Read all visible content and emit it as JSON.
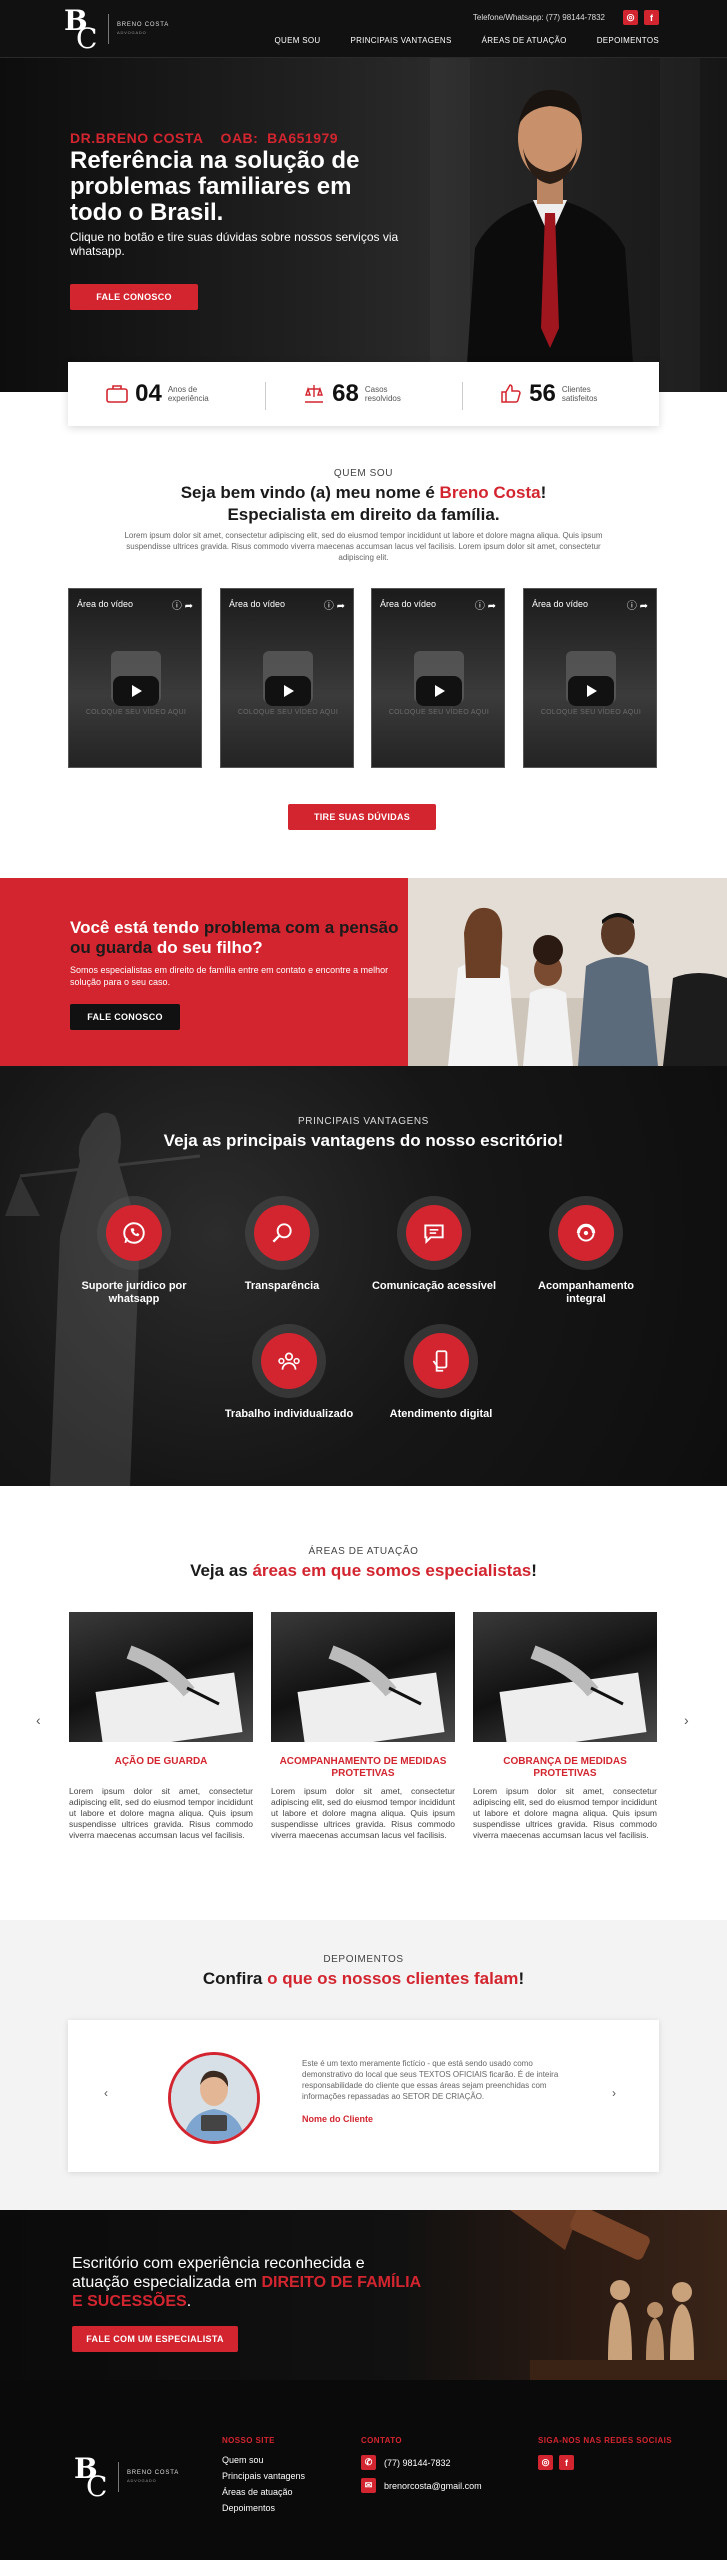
{
  "header": {
    "logo_text_1": "BRENO COSTA",
    "logo_text_2": "ADVOGADO",
    "phone": "Telefone/Whatsapp: (77) 98144-7832",
    "nav": [
      "QUEM SOU",
      "PRINCIPAIS VANTAGENS",
      "ÁREAS DE ATUAÇÃO",
      "DEPOIMENTOS"
    ]
  },
  "hero": {
    "kicker": "DR.BRENO COSTA    OAB:  BA651979",
    "title": "Referência na solução de problemas familiares em todo o Brasil.",
    "subtitle": "Clique no botão e tire suas dúvidas sobre nossos serviços via whatsapp.",
    "button": "FALE CONOSCO"
  },
  "stats": [
    {
      "icon": "briefcase-icon",
      "number": "04",
      "label": "Anos de experiência"
    },
    {
      "icon": "scale-hand-icon",
      "number": "68",
      "label": "Casos resolvidos"
    },
    {
      "icon": "thumbs-up-icon",
      "number": "56",
      "label": "Clientes satisfeitos"
    }
  ],
  "about": {
    "kicker": "QUEM SOU",
    "title_pre": "Seja bem vindo (a) meu nome é ",
    "title_name": "Breno Costa",
    "title_post": "!",
    "title_line2": "Especialista em direito da família.",
    "text": "Lorem ipsum dolor sit amet, consectetur adipiscing elit, sed do eiusmod tempor incididunt ut labore et dolore magna aliqua. Quis ipsum suspendisse ultrices gravida. Risus commodo viverra maecenas accumsan lacus vel facilisis.  Lorem ipsum dolor sit amet, consectetur adipiscing elit.",
    "videos": [
      {
        "title": "Área do vídeo",
        "caption": "COLOQUE SEU VÍDEO AQUI"
      },
      {
        "title": "Área do vídeo",
        "caption": "COLOQUE SEU VÍDEO AQUI"
      },
      {
        "title": "Área do vídeo",
        "caption": "COLOQUE SEU VÍDEO AQUI"
      },
      {
        "title": "Área do vídeo",
        "caption": "COLOQUE SEU VÍDEO AQUI"
      }
    ],
    "button": "TIRE SUAS DÚVIDAS"
  },
  "problem": {
    "t1": "Você está tendo ",
    "t2": "problema com a pensão ou guarda",
    "t3": " do seu filho?",
    "text": "Somos especialistas em direito de família entre em contato e encontre a melhor solução para o seu caso.",
    "button": "FALE CONOSCO"
  },
  "advantages": {
    "kicker": "PRINCIPAIS VANTAGENS",
    "title": "Veja as principais vantagens do nosso escritório!",
    "items": [
      {
        "icon": "whatsapp-icon",
        "label": "Suporte jurídico por whatsapp"
      },
      {
        "icon": "magnifier-icon",
        "label": "Transparência"
      },
      {
        "icon": "chat-icon",
        "label": "Comunicação acessível"
      },
      {
        "icon": "support-icon",
        "label": "Acompanhamento integral"
      },
      {
        "icon": "team-icon",
        "label": "Trabalho individualizado"
      },
      {
        "icon": "phone-hand-icon",
        "label": "Atendimento digital"
      }
    ]
  },
  "areas": {
    "kicker": "ÁREAS DE ATUAÇÃO",
    "title_pre": "Veja as ",
    "title_red": "áreas em que somos especialistas",
    "title_post": "!",
    "cards": [
      {
        "title": "AÇÃO DE GUARDA",
        "text": "Lorem ipsum dolor sit amet, consectetur adipiscing elit, sed do eiusmod tempor incididunt ut labore et dolore magna aliqua. Quis ipsum suspendisse ultrices gravida. Risus commodo viverra maecenas accumsan lacus vel facilisis."
      },
      {
        "title": "ACOMPANHAMENTO DE MEDIDAS PROTETIVAS",
        "text": "Lorem ipsum dolor sit amet, consectetur adipiscing elit, sed do eiusmod tempor incididunt ut labore et dolore magna aliqua. Quis ipsum suspendisse ultrices gravida. Risus commodo viverra maecenas accumsan lacus vel facilisis."
      },
      {
        "title": "COBRANÇA DE MEDIDAS PROTETIVAS",
        "text": "Lorem ipsum dolor sit amet, consectetur adipiscing elit, sed do eiusmod tempor incididunt ut labore et dolore magna aliqua. Quis ipsum suspendisse ultrices gravida. Risus commodo viverra maecenas accumsan lacus vel facilisis."
      }
    ]
  },
  "testimonials": {
    "kicker": "DEPOIMENTOS",
    "title_pre": "Confira ",
    "title_red": "o que os nossos clientes falam",
    "title_post": "!",
    "text": "Este é um texto meramente fictício - que está sendo usado como demonstrativo do local que seus TEXTOS OFICIAIS ficarão. É de inteira responsabilidade do cliente que essas áreas sejam preenchidas com informações repassadas ao SETOR DE CRIAÇÃO.",
    "name": "Nome do Cliente"
  },
  "cta": {
    "t1": "Escritório com experiência reconhecida e atuação especializada em ",
    "t2": "direito de família e sucessões",
    "t3": ".",
    "button": "FALE COM UM ESPECIALISTA"
  },
  "footer": {
    "site_head": "NOSSO SITE",
    "site_links": [
      "Quem sou",
      "Principais vantagens",
      "Áreas de atuação",
      "Depoimentos"
    ],
    "contact_head": "CONTATO",
    "phone": "(77) 98144-7832",
    "email": "brenorcosta@gmail.com",
    "social_head": "SIGA-NOS NAS REDES SOCIAIS"
  },
  "colors": {
    "accent": "#d3252f",
    "dark": "#111111"
  }
}
